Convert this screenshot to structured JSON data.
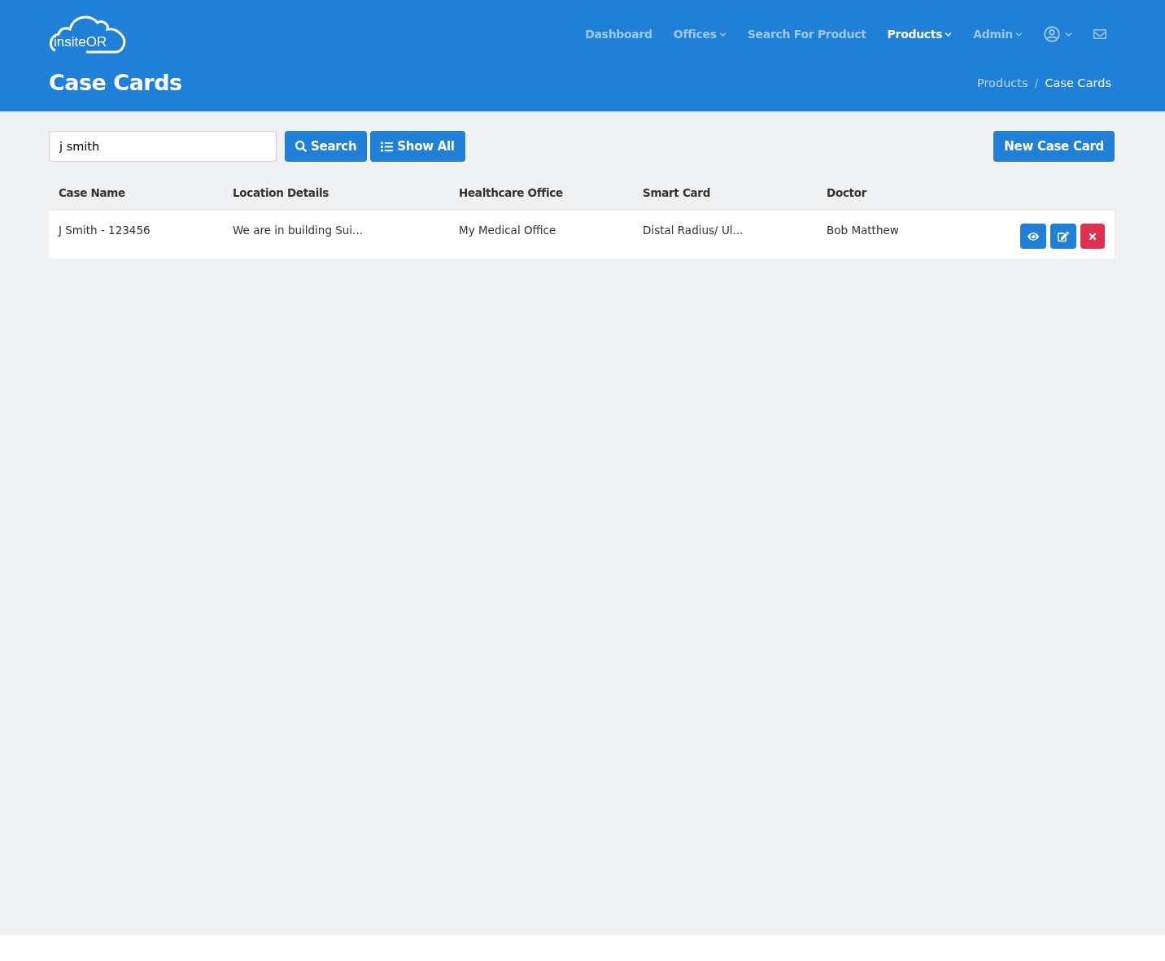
{
  "header": {
    "logo": "insiteOR",
    "title": "Case Cards",
    "nav": [
      {
        "label": "Dashboard",
        "selected": false,
        "dropdown": false
      },
      {
        "label": "Offices",
        "selected": false,
        "dropdown": true
      },
      {
        "label": "Search For Product",
        "selected": false,
        "dropdown": false
      },
      {
        "label": "Products",
        "selected": true,
        "dropdown": true
      },
      {
        "label": "Admin",
        "selected": false,
        "dropdown": true
      }
    ],
    "breadcrumb_separator": "/",
    "breadcrumb": [
      {
        "label": "Products",
        "selected": false
      },
      {
        "label": "Case Cards",
        "selected": true
      }
    ]
  },
  "toolbar": {
    "search_value": "j smith",
    "search_button": "Search",
    "show_all_button": "Show All",
    "new_button": "New Case Card"
  },
  "table": {
    "columns": [
      "Case Name",
      "Location Details",
      "Healthcare Office",
      "Smart Card",
      "Doctor"
    ],
    "rows": [
      {
        "cells": [
          "J Smith - 123456",
          "We are in building Sui...",
          "My Medical Office",
          "Distal Radius/ Ul...",
          "Bob Matthew"
        ]
      }
    ]
  }
}
